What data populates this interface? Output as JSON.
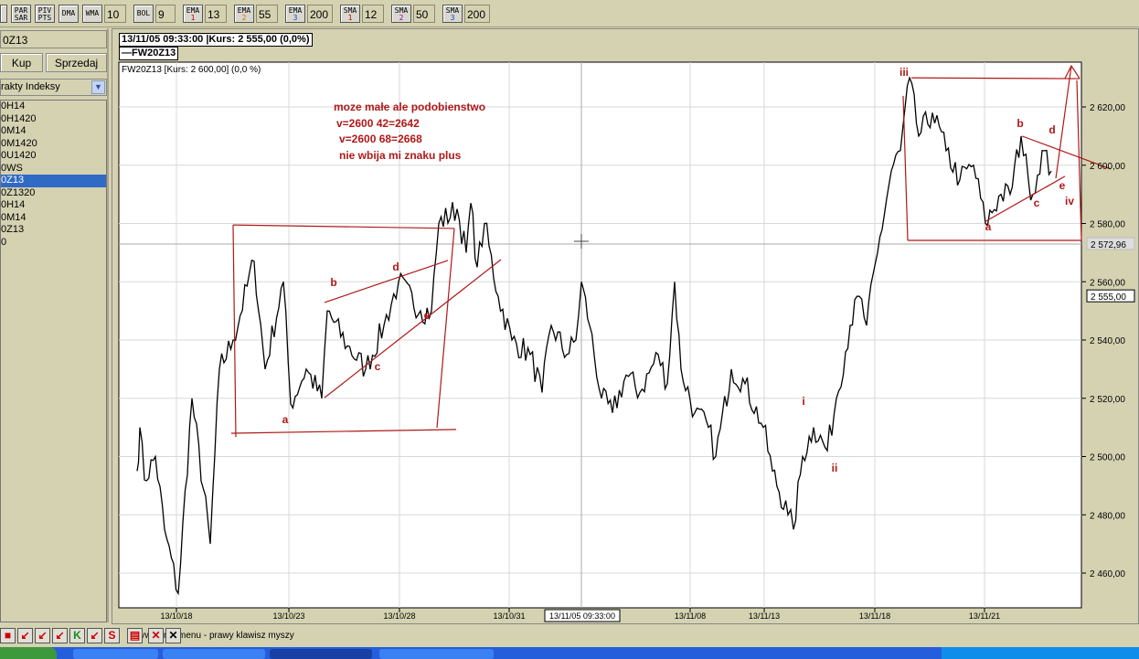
{
  "toolbar": {
    "buttons": [
      {
        "label": "PAR SAR"
      },
      {
        "label": "PIV PTS"
      },
      {
        "label": "DMA"
      },
      {
        "label": "WMA",
        "value": "10"
      },
      {
        "label": "BOL",
        "value": "9"
      },
      {
        "label": "EMA",
        "sub": "1",
        "value": "13",
        "color": "#cc0000"
      },
      {
        "label": "EMA",
        "sub": "2",
        "value": "55",
        "color": "#e07000"
      },
      {
        "label": "EMA",
        "sub": "3",
        "value": "200",
        "color": "#2040c0"
      },
      {
        "label": "SMA",
        "sub": "1",
        "value": "12",
        "color": "#cc0000"
      },
      {
        "label": "SMA",
        "sub": "2",
        "value": "50",
        "color": "#a000a0"
      },
      {
        "label": "SMA",
        "sub": "3",
        "value": "200",
        "color": "#2040c0"
      }
    ]
  },
  "left_panel": {
    "symbol": "0Z13",
    "buy_label": "Kup",
    "sell_label": "Sprzedaj",
    "category": "rakty Indeksy",
    "items": [
      "0H14",
      "0H1420",
      "0M14",
      "0M1420",
      "0U1420",
      "0WS",
      "0Z13",
      "0Z1320",
      "0H14",
      "0M14",
      "0Z13",
      "0"
    ],
    "selected_index": 6
  },
  "chart_header": {
    "cursor_info": "13/11/05 09:33:00 |Kurs: 2 555,00 (0,0%)",
    "legend": "FW20Z13",
    "subtitle": "FW20Z13 [Kurs: 2 600,00] (0,0 %)"
  },
  "notes": [
    "moze małe ale podobienstwo",
    "v=2600  42=2642",
    "v=2600  68=2668",
    "nie wbija mi znaku plus"
  ],
  "chart_data": {
    "type": "line",
    "title": "FW20Z13",
    "ylim": [
      2440,
      2640
    ],
    "yticks": [
      {
        "v": 2460,
        "label": "2 460,00"
      },
      {
        "v": 2480,
        "label": "2 480,00"
      },
      {
        "v": 2500,
        "label": "2 500,00"
      },
      {
        "v": 2520,
        "label": "2 520,00"
      },
      {
        "v": 2540,
        "label": "2 540,00"
      },
      {
        "v": 2560,
        "label": "2 560,00"
      },
      {
        "v": 2580,
        "label": "2 580,00"
      },
      {
        "v": 2600,
        "label": "2 600,00"
      },
      {
        "v": 2620,
        "label": "2 620,00"
      }
    ],
    "xticks": [
      {
        "t": 6.3,
        "label": "13/10/18"
      },
      {
        "t": 18.6,
        "label": "13/10/23"
      },
      {
        "t": 30.7,
        "label": "13/10/28"
      },
      {
        "t": 42.7,
        "label": "13/10/31"
      },
      {
        "t": 62.5,
        "label": "13/11/08"
      },
      {
        "t": 70.6,
        "label": "13/11/13"
      },
      {
        "t": 82.7,
        "label": "13/11/18"
      },
      {
        "t": 94.7,
        "label": "13/11/21"
      }
    ],
    "crosshair": {
      "t": 50.6,
      "price": 2572.96,
      "time_label": "13/11/05 09:33:00",
      "price_label": "2 572,96"
    },
    "last_price": {
      "price": 2555,
      "label": "2 555,00"
    },
    "series": [
      [
        2,
        2495
      ],
      [
        2.3,
        2510
      ],
      [
        2.8,
        2492
      ],
      [
        4,
        2500
      ],
      [
        5,
        2475
      ],
      [
        6.5,
        2453
      ],
      [
        8,
        2520
      ],
      [
        10,
        2470
      ],
      [
        11,
        2530
      ],
      [
        12.5,
        2540
      ],
      [
        14.8,
        2567
      ],
      [
        16,
        2530
      ],
      [
        18,
        2560
      ],
      [
        18.8,
        2518
      ],
      [
        20.5,
        2530
      ],
      [
        22.2,
        2520
      ],
      [
        22.8,
        2550
      ],
      [
        25,
        2538
      ],
      [
        27,
        2530
      ],
      [
        29,
        2545
      ],
      [
        30.6,
        2560
      ],
      [
        33,
        2550
      ],
      [
        34.2,
        2550
      ],
      [
        35,
        2580
      ],
      [
        37,
        2585
      ],
      [
        38,
        2570
      ],
      [
        38.5,
        2587
      ],
      [
        39.2,
        2565
      ],
      [
        40,
        2580
      ],
      [
        41.5,
        2555
      ],
      [
        43,
        2540
      ],
      [
        45,
        2535
      ],
      [
        46.3,
        2522
      ],
      [
        47.3,
        2545
      ],
      [
        49,
        2535
      ],
      [
        50,
        2540
      ],
      [
        50.6,
        2560
      ],
      [
        51.5,
        2545
      ],
      [
        52.8,
        2520
      ],
      [
        54,
        2515
      ],
      [
        55.5,
        2528
      ],
      [
        57,
        2522
      ],
      [
        59,
        2535
      ],
      [
        60,
        2525
      ],
      [
        60.8,
        2560
      ],
      [
        61.5,
        2530
      ],
      [
        63,
        2515
      ],
      [
        64.5,
        2510
      ],
      [
        65.3,
        2500
      ],
      [
        67,
        2530
      ],
      [
        68.5,
        2525
      ],
      [
        70.5,
        2510
      ],
      [
        71.5,
        2495
      ],
      [
        73.2,
        2480
      ],
      [
        73.8,
        2475
      ],
      [
        74.8,
        2500
      ],
      [
        76,
        2510
      ],
      [
        77.5,
        2502
      ],
      [
        78.5,
        2520
      ],
      [
        80,
        2545
      ],
      [
        81,
        2555
      ],
      [
        81.8,
        2545
      ],
      [
        83,
        2570
      ],
      [
        84.5,
        2598
      ],
      [
        85.5,
        2605
      ],
      [
        86.5,
        2630
      ],
      [
        87.5,
        2610
      ],
      [
        89,
        2618
      ],
      [
        90.5,
        2605
      ],
      [
        92,
        2595
      ],
      [
        93.5,
        2600
      ],
      [
        94.8,
        2580
      ],
      [
        96.5,
        2590
      ],
      [
        97.5,
        2590
      ],
      [
        98.7,
        2610
      ],
      [
        99.5,
        2595
      ],
      [
        100,
        2590
      ],
      [
        101,
        2605
      ],
      [
        102,
        2598
      ]
    ],
    "annotations": {
      "labels": [
        {
          "text": "a",
          "t": 18.2,
          "price": 2511.5
        },
        {
          "text": "b",
          "t": 23.5,
          "price": 2558.5
        },
        {
          "text": "c",
          "t": 28.3,
          "price": 2529.6
        },
        {
          "text": "d",
          "t": 30.3,
          "price": 2563.8
        },
        {
          "text": "e",
          "t": 33.7,
          "price": 2547.2
        },
        {
          "text": "i",
          "t": 74.9,
          "price": 2517.7
        },
        {
          "text": "ii",
          "t": 78.3,
          "price": 2494.8
        },
        {
          "text": "iii",
          "t": 85.9,
          "price": 2630.7
        },
        {
          "text": "a",
          "t": 95.1,
          "price": 2577.6
        },
        {
          "text": "b",
          "t": 98.6,
          "price": 2613.1
        },
        {
          "text": "c",
          "t": 100.4,
          "price": 2585.8
        },
        {
          "text": "d",
          "t": 102.1,
          "price": 2610.9
        },
        {
          "text": "e",
          "t": 103.2,
          "price": 2591.8
        },
        {
          "text": "iv",
          "t": 104,
          "price": 2586.4
        }
      ],
      "lines": [
        [
          12.5,
          2579.5,
          12.8,
          2506.7
        ],
        [
          12.5,
          2579.5,
          36.7,
          2578.3
        ],
        [
          12.3,
          2508.0,
          36.9,
          2509.3
        ],
        [
          36.7,
          2578.3,
          34.8,
          2509.9
        ],
        [
          22.5,
          2552.9,
          36.0,
          2567.3
        ],
        [
          22.5,
          2520.2,
          41.8,
          2567.6
        ],
        [
          85.8,
          2623.8,
          86.3,
          2574.2
        ],
        [
          86.3,
          2574.2,
          105.3,
          2574.2
        ],
        [
          86.7,
          2630.0,
          105.1,
          2629.7
        ],
        [
          104.8,
          2629.1,
          105.3,
          2574.2
        ],
        [
          102.5,
          2595.5,
          104.2,
          2634.1
        ],
        [
          94.7,
          2580.5,
          103.5,
          2596.2
        ],
        [
          98.8,
          2610.0,
          108.5,
          2598.7
        ]
      ],
      "color": "#b01818"
    }
  },
  "status": {
    "hint": "Wywołanie menu - prawy klawisz myszy",
    "buttons": [
      "save",
      "zoom-in",
      "zoom-out",
      "fit",
      "K",
      "frame",
      "S",
      "print",
      "delete-red",
      "delete-black"
    ]
  }
}
